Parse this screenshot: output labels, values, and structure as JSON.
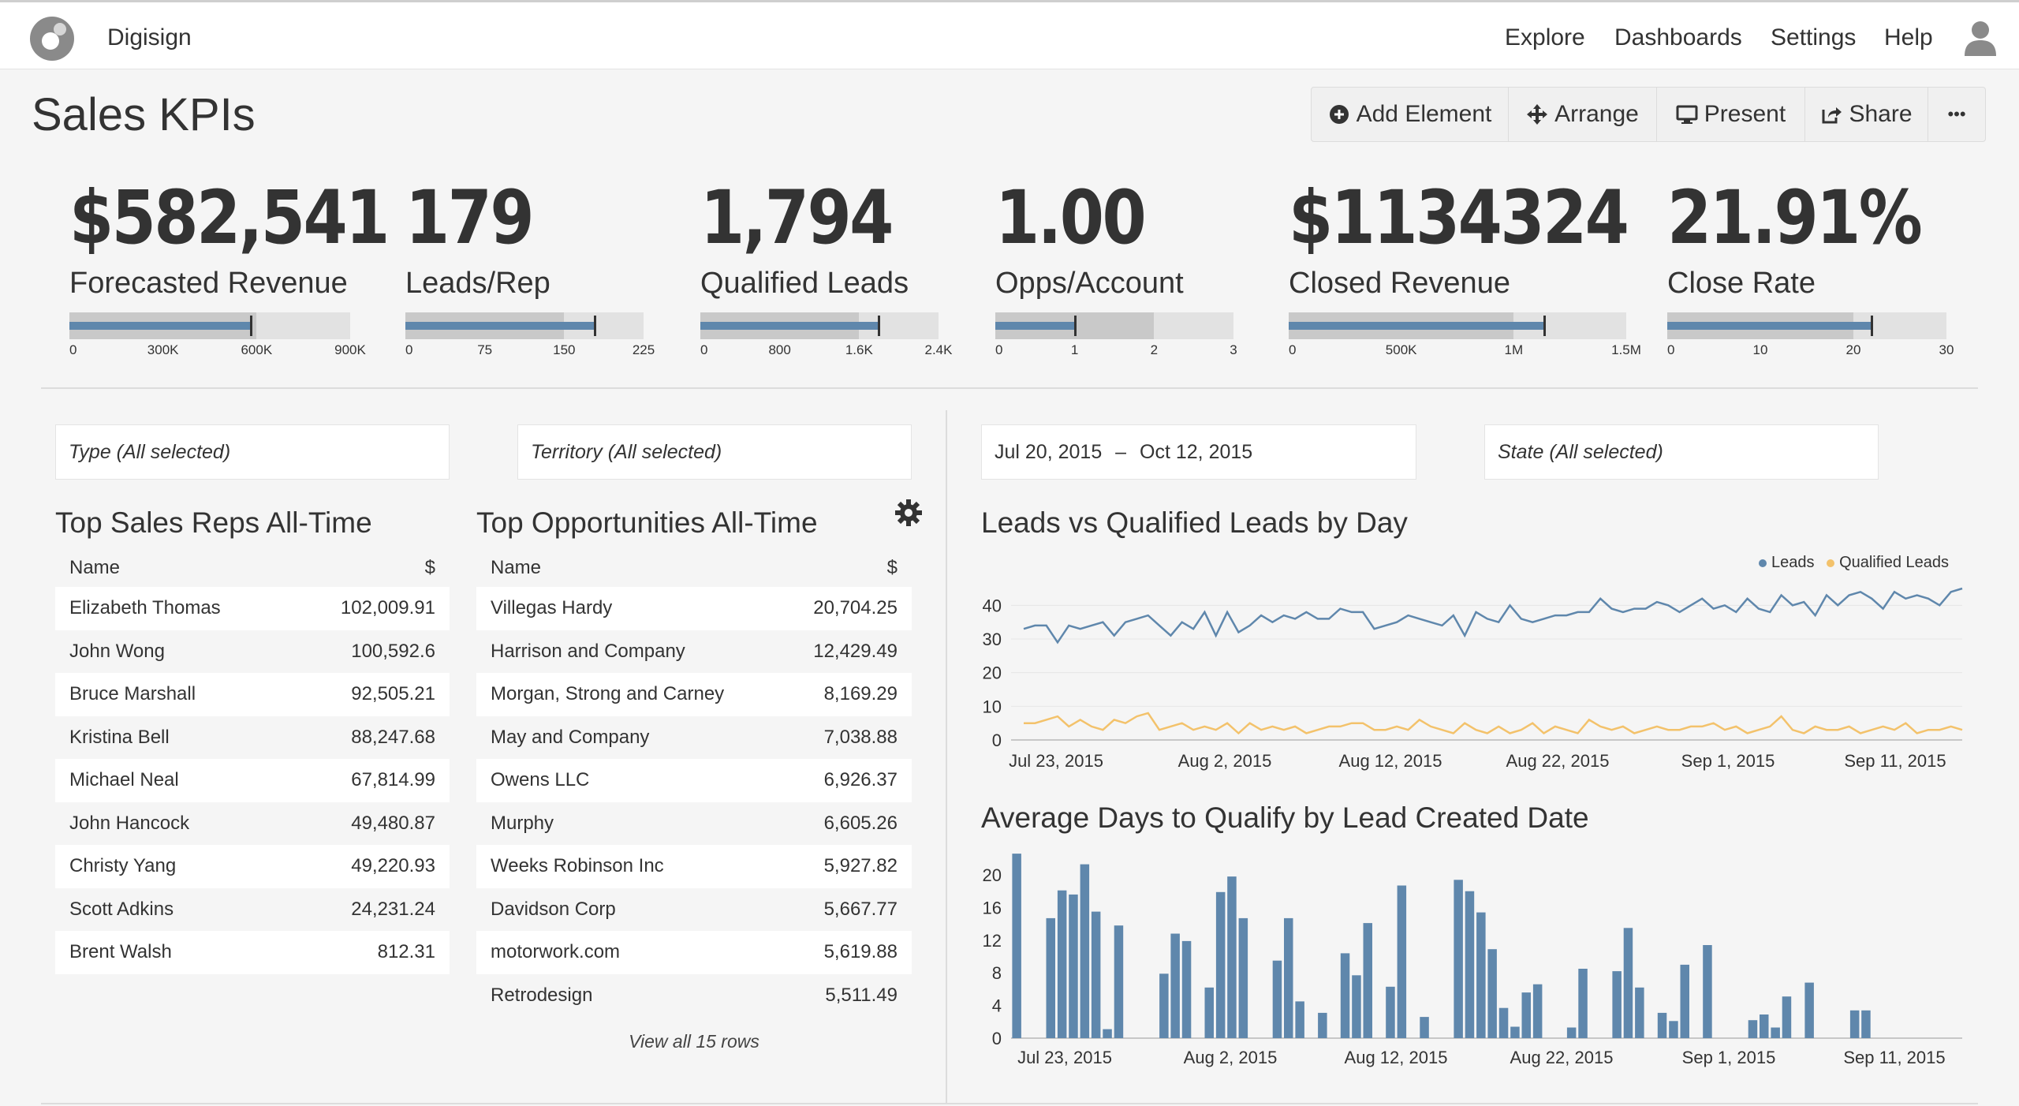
{
  "app": {
    "brand": "Digisign"
  },
  "nav": {
    "items": [
      "Explore",
      "Dashboards",
      "Settings",
      "Help"
    ]
  },
  "page": {
    "title": "Sales KPIs"
  },
  "toolbar": {
    "add_element": "Add Element",
    "arrange": "Arrange",
    "present": "Present",
    "share": "Share",
    "more": "•••"
  },
  "kpis": [
    {
      "value": "$582,541",
      "label": "Forecasted Revenue",
      "max": 900000,
      "actual": 582541,
      "band": 600000,
      "target": 582541,
      "ticks": [
        "0",
        "300K",
        "600K",
        "900K"
      ]
    },
    {
      "value": "179",
      "label": "Leads/Rep",
      "max": 225,
      "actual": 179,
      "band": 150,
      "target": 179,
      "ticks": [
        "0",
        "75",
        "150",
        "225"
      ]
    },
    {
      "value": "1,794",
      "label": "Qualified Leads",
      "max": 2400,
      "actual": 1794,
      "band": 1600,
      "target": 1794,
      "ticks": [
        "0",
        "800",
        "1.6K",
        "2.4K"
      ]
    },
    {
      "value": "1.00",
      "label": "Opps/Account",
      "max": 3,
      "actual": 1,
      "band": 2,
      "target": 1,
      "ticks": [
        "0",
        "1",
        "2",
        "3"
      ]
    },
    {
      "value": "$1134324",
      "label": "Closed Revenue",
      "max": 1500000,
      "actual": 1134324,
      "band": 1000000,
      "target": 1134324,
      "ticks": [
        "0",
        "500K",
        "1M",
        "1.5M"
      ]
    },
    {
      "value": "21.91%",
      "label": "Close Rate",
      "max": 30,
      "actual": 21.91,
      "band": 20,
      "target": 21.91,
      "ticks": [
        "0",
        "10",
        "20",
        "30"
      ]
    }
  ],
  "filters": {
    "type": "Type (All selected)",
    "territory": "Territory (All selected)",
    "date_start": "Jul 20, 2015",
    "date_sep": "–",
    "date_end": "Oct 12, 2015",
    "state": "State (All selected)"
  },
  "top_reps": {
    "title": "Top Sales Reps All-Time",
    "columns": [
      "Name",
      "$"
    ],
    "rows": [
      [
        "Elizabeth Thomas",
        "102,009.91"
      ],
      [
        "John Wong",
        "100,592.6"
      ],
      [
        "Bruce Marshall",
        "92,505.21"
      ],
      [
        "Kristina Bell",
        "88,247.68"
      ],
      [
        "Michael Neal",
        "67,814.99"
      ],
      [
        "John Hancock",
        "49,480.87"
      ],
      [
        "Christy Yang",
        "49,220.93"
      ],
      [
        "Scott Adkins",
        "24,231.24"
      ],
      [
        "Brent Walsh",
        "812.31"
      ]
    ]
  },
  "top_opps": {
    "title": "Top Opportunities All-Time",
    "columns": [
      "Name",
      "$"
    ],
    "rows": [
      [
        "Villegas Hardy",
        "20,704.25"
      ],
      [
        "Harrison and Company",
        "12,429.49"
      ],
      [
        "Morgan, Strong and Carney",
        "8,169.29"
      ],
      [
        "May and Company",
        "7,038.88"
      ],
      [
        "Owens LLC",
        "6,926.37"
      ],
      [
        "Murphy",
        "6,605.26"
      ],
      [
        "Weeks Robinson Inc",
        "5,927.82"
      ],
      [
        "Davidson Corp",
        "5,667.77"
      ],
      [
        "motorwork.com",
        "5,619.88"
      ],
      [
        "Retrodesign",
        "5,511.49"
      ]
    ],
    "view_all": "View all 15 rows"
  },
  "colors": {
    "leads": "#5f87ac",
    "qualified": "#f3c26b",
    "bar": "#5f87ac"
  },
  "chart_data": [
    {
      "type": "line",
      "title": "Leads vs Qualified Leads by Day",
      "x_tick_labels": [
        "Jul 23, 2015",
        "Aug 2, 2015",
        "Aug 12, 2015",
        "Aug 22, 2015",
        "Sep 1, 2015",
        "Sep 11, 2015"
      ],
      "x_range": [
        "Jul 20, 2015",
        "Oct 11, 2015"
      ],
      "yticks": [
        0,
        10,
        20,
        30,
        40
      ],
      "ylim": [
        0,
        45
      ],
      "legend_position": "top-right",
      "series": [
        {
          "name": "Leads",
          "values": [
            33,
            34,
            34,
            29,
            34,
            33,
            34,
            35,
            31,
            35,
            36,
            37,
            34,
            31,
            35,
            33,
            38,
            31,
            38,
            32,
            34,
            37,
            35,
            37,
            36,
            38,
            36,
            36,
            39,
            38,
            38,
            33,
            34,
            35,
            37,
            36,
            35,
            34,
            37,
            31,
            38,
            36,
            35,
            40,
            36,
            35,
            36,
            37,
            37,
            38,
            38,
            42,
            39,
            38,
            39,
            39,
            41,
            40,
            38,
            40,
            42,
            39,
            40,
            38,
            42,
            39,
            38,
            43,
            40,
            41,
            37,
            43,
            40,
            43,
            44,
            42,
            39,
            44,
            42,
            43,
            42,
            40,
            44,
            45
          ]
        },
        {
          "name": "Qualified Leads",
          "values": [
            5,
            5,
            6,
            7,
            4,
            6,
            4,
            3,
            6,
            5,
            7,
            8,
            3,
            4,
            5,
            3,
            4,
            3,
            5,
            2,
            5,
            3,
            4,
            3,
            4,
            2,
            3,
            4,
            4,
            5,
            5,
            3,
            3,
            4,
            3,
            6,
            4,
            3,
            2,
            5,
            3,
            2,
            4,
            2,
            3,
            5,
            2,
            4,
            3,
            2,
            6,
            4,
            3,
            4,
            2,
            3,
            4,
            3,
            3,
            4,
            4,
            5,
            3,
            4,
            2,
            3,
            4,
            7,
            3,
            2,
            4,
            3,
            3,
            4,
            2,
            3,
            4,
            3,
            5,
            2,
            3,
            3,
            4,
            3
          ]
        }
      ]
    },
    {
      "type": "bar",
      "title": "Average Days to Qualify by Lead Created Date",
      "x_tick_labels": [
        "Jul 23, 2015",
        "Aug 2, 2015",
        "Aug 12, 2015",
        "Aug 22, 2015",
        "Sep 1, 2015",
        "Sep 11, 2015"
      ],
      "x_range": [
        "Jul 20, 2015",
        "Oct 11, 2015"
      ],
      "yticks": [
        0,
        4,
        8,
        12,
        16,
        20
      ],
      "ylim": [
        0,
        23
      ],
      "values": [
        22.6,
        0,
        0,
        14.7,
        18.1,
        17.6,
        21.3,
        15.5,
        1.1,
        13.8,
        0,
        0,
        0,
        7.9,
        12.8,
        11.9,
        0,
        6.2,
        17.9,
        19.8,
        14.7,
        0,
        0,
        9.5,
        14.7,
        4.5,
        0,
        3.1,
        0,
        10.4,
        7.7,
        14.1,
        0,
        6.3,
        18.7,
        0,
        2.6,
        0,
        0,
        19.4,
        18.0,
        15.4,
        10.9,
        3.7,
        1.4,
        5.6,
        6.6,
        0,
        0,
        1.3,
        8.5,
        0,
        0,
        8.2,
        13.5,
        6.2,
        0,
        3.1,
        2.1,
        9.0,
        0,
        11.4,
        0,
        0,
        0,
        2.2,
        2.9,
        1.3,
        5.1,
        0,
        6.8,
        0,
        0,
        0,
        3.4,
        3.4,
        0,
        0,
        0,
        0,
        0,
        0,
        0,
        0
      ]
    }
  ]
}
